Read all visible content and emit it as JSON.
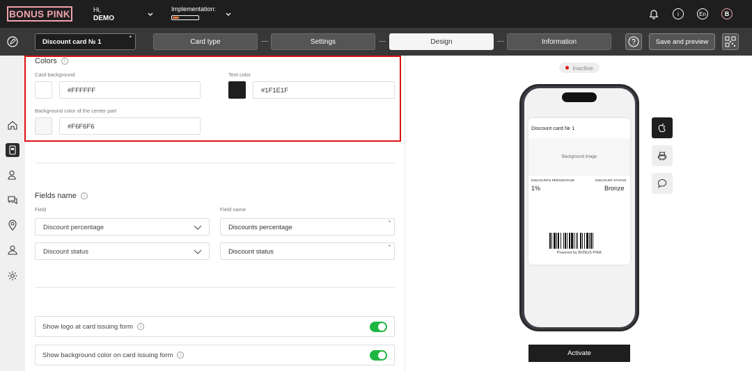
{
  "header": {
    "logo": "BONUS PINK",
    "greeting": "Hi,",
    "account": "DEMO",
    "implementation_label": "Implementation:",
    "implementation_progress": 0.25,
    "language": "En",
    "avatar_letter": "B"
  },
  "nav": {
    "card_name": "Discount card № 1",
    "steps": [
      "Card type",
      "Settings",
      "Design",
      "Information"
    ],
    "active_step": "Design",
    "save_label": "Save and preview"
  },
  "colors": {
    "title": "Colors",
    "card_background_label": "Card background",
    "card_background_value": "#FFFFFF",
    "text_color_label": "Text color",
    "text_color_value": "#1F1E1F",
    "center_bg_label": "Background color of the center part",
    "center_bg_value": "#F6F6F6"
  },
  "fields": {
    "title": "Fields name",
    "col_field": "Field",
    "col_name": "Field name",
    "rows": [
      {
        "field": "Discount percentage",
        "name": "Discounts percentage"
      },
      {
        "field": "Discount status",
        "name": "Discount status"
      }
    ]
  },
  "toggles": [
    {
      "label": "Show logo at card issuing form",
      "on": true
    },
    {
      "label": "Show background color on card issuing form",
      "on": true
    }
  ],
  "preview": {
    "status": "Inactive",
    "card_title": "Discount card № 1",
    "background_image": "Background image",
    "field1_label": "DISCOUNTS PERCENTAGE",
    "field1_value": "1%",
    "field2_label": "DISCOUNT STATUS",
    "field2_value": "Bronze",
    "powered": "Powered by BONUS PINK",
    "activate": "Activate"
  },
  "accent": {
    "highlight": "#dd1111",
    "toggle_on": "#1fb542",
    "brand": "#f0a3ac",
    "progress": "#e8762b"
  }
}
